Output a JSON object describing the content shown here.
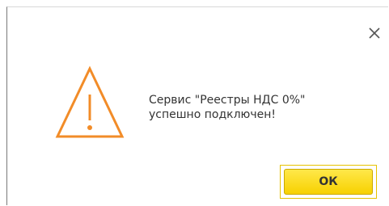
{
  "message": {
    "line1": "Сервис \"Реестры НДС 0%\"",
    "line2": "успешно подключен!"
  },
  "buttons": {
    "ok_label": "ОК"
  },
  "icons": {
    "close": "close-icon",
    "warning": "warning-triangle-icon"
  },
  "colors": {
    "warning_orange": "#F28C28",
    "ok_button_fill": "#F7D100",
    "ok_button_border": "#E6C200"
  }
}
